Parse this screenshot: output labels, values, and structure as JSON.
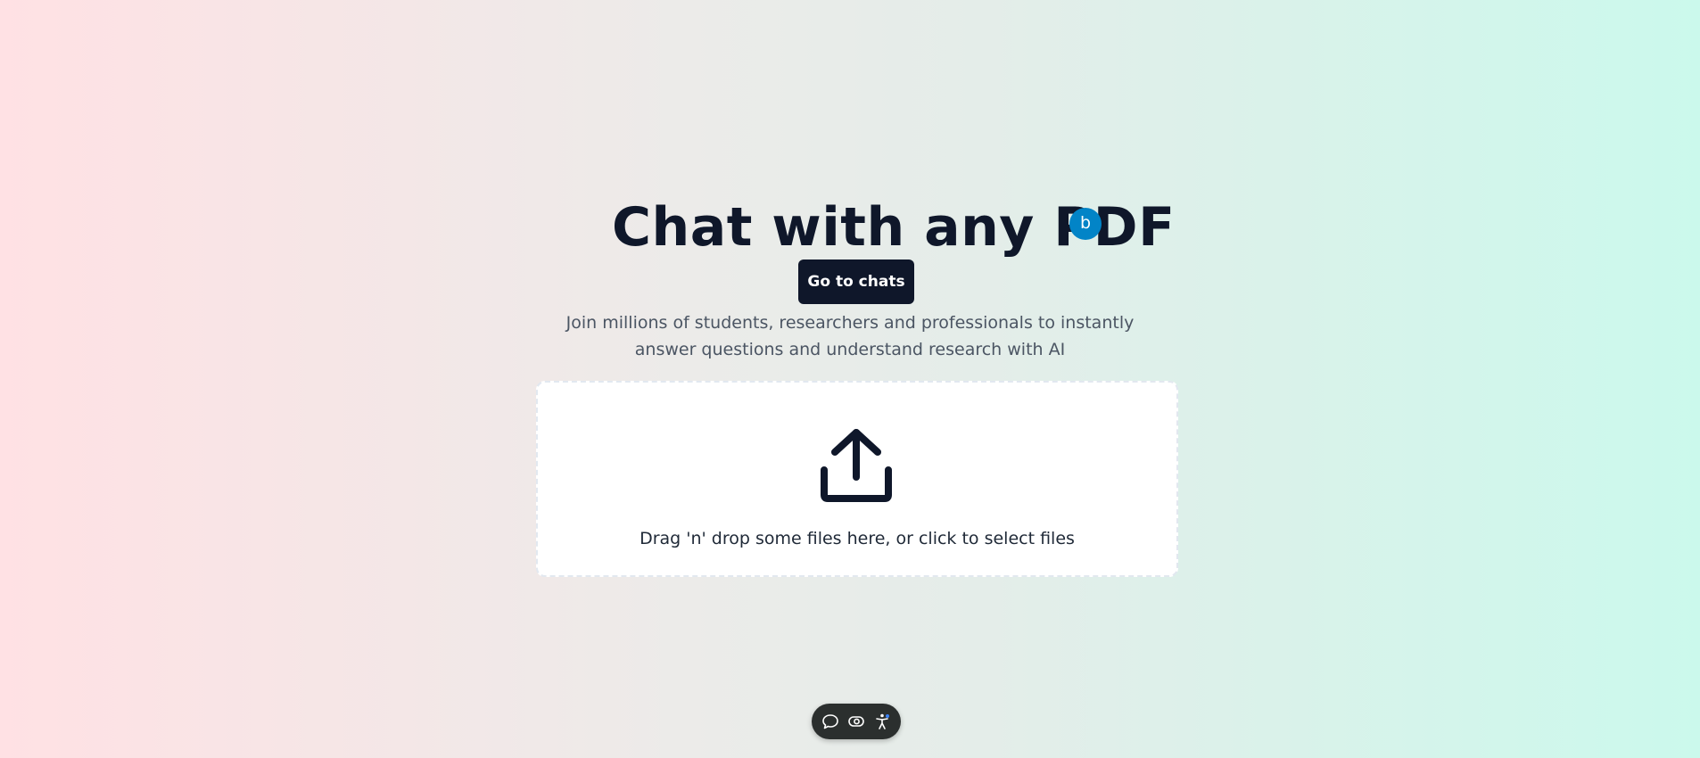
{
  "hero": {
    "title": "Chat with any PDF",
    "avatar_initial": "b",
    "go_to_chats_label": "Go to chats",
    "subtitle": "Join millions of students, researchers and professionals to instantly answer questions and understand research with AI"
  },
  "dropzone": {
    "icon": "upload-icon",
    "text": "Drag 'n' drop some files here, or click to select files"
  },
  "toolbar": {
    "items": [
      {
        "icon": "chat-bubble-icon"
      },
      {
        "icon": "eye-toggle-icon"
      },
      {
        "icon": "accessibility-icon"
      }
    ]
  },
  "colors": {
    "primary": "#0f172a",
    "avatar": "#0284c7",
    "gradient_left": "#ffe1e4",
    "gradient_right": "#cbf9ec"
  }
}
